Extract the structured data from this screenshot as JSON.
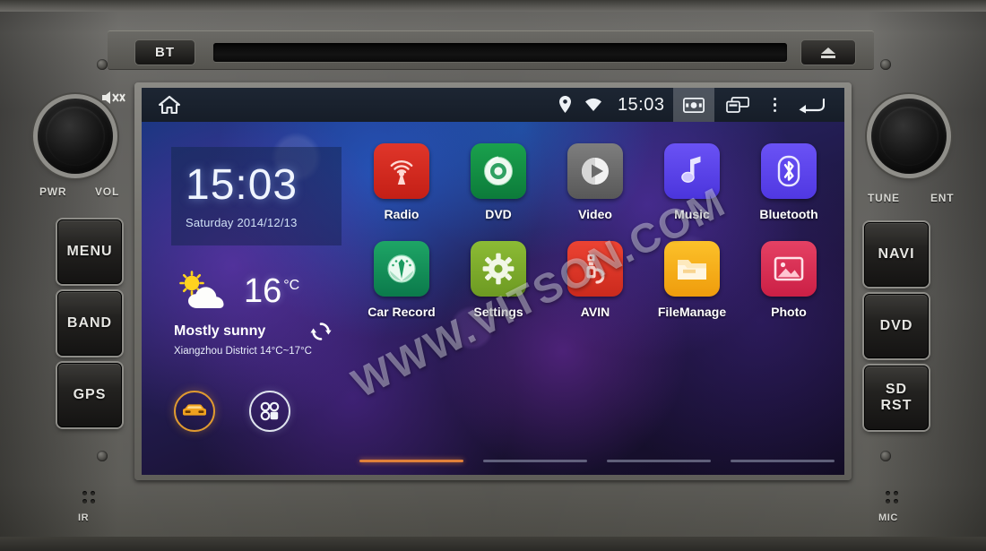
{
  "device": {
    "top": {
      "bt_label": "BT",
      "eject_icon": "eject-icon",
      "disc_slot": "disc-slot"
    },
    "left": {
      "knob_icon": "volume-knob",
      "mute_icon": "mute-icon",
      "label_pwr": "PWR",
      "label_vol": "VOL",
      "buttons": [
        {
          "label": "MENU",
          "name": "menu-button"
        },
        {
          "label": "BAND",
          "name": "band-button"
        },
        {
          "label": "GPS",
          "name": "gps-button"
        }
      ]
    },
    "right": {
      "knob_icon": "tune-knob",
      "label_tune": "TUNE",
      "label_ent": "ENT",
      "buttons": [
        {
          "label": "NAVI",
          "name": "navi-button"
        },
        {
          "label": "DVD",
          "name": "dvd-button"
        },
        {
          "label_line1": "SD",
          "label_line2": "RST",
          "name": "sd-rst-button"
        }
      ]
    },
    "bottom": {
      "ir_label": "IR",
      "mic_label": "MIC"
    }
  },
  "screen": {
    "statusbar": {
      "home_icon": "home-icon",
      "location_icon": "location-pin-icon",
      "wifi_icon": "wifi-icon",
      "clock": "15:03",
      "screenshot_icon": "screenshot-icon",
      "recents_icon": "recents-icon",
      "overflow_icon": "overflow-menu-icon",
      "back_icon": "back-arrow-icon"
    },
    "clock_widget": {
      "time": "15:03",
      "date": "Saturday 2014/12/13"
    },
    "weather_widget": {
      "icon": "sun-behind-cloud-icon",
      "temperature": "16",
      "unit": "°C",
      "condition": "Mostly sunny",
      "location_range": "Xiangzhou District 14°C~17°C",
      "refresh_icon": "refresh-icon"
    },
    "dock": [
      {
        "name": "car-mode-button",
        "icon": "car-icon"
      },
      {
        "name": "app-drawer-button",
        "icon": "apps-grid-icon"
      }
    ],
    "apps": [
      {
        "label": "Radio",
        "name": "app-radio",
        "icon": "radio-broadcast-icon",
        "color": "#d32a20"
      },
      {
        "label": "DVD",
        "name": "app-dvd",
        "icon": "disc-icon",
        "color": "#159146"
      },
      {
        "label": "Video",
        "name": "app-video",
        "icon": "play-circle-icon",
        "color": "#6d6d6d"
      },
      {
        "label": "Music",
        "name": "app-music",
        "icon": "music-note-icon",
        "color": "#5b46e8"
      },
      {
        "label": "Bluetooth",
        "name": "app-bluetooth",
        "icon": "bluetooth-icon",
        "color": "#5b46e8"
      },
      {
        "label": "Car Record",
        "name": "app-car-record",
        "icon": "gauge-icon",
        "color": "#108a57"
      },
      {
        "label": "Settings",
        "name": "app-settings",
        "icon": "gear-icon",
        "color": "#7aa82c"
      },
      {
        "label": "AVIN",
        "name": "app-avin",
        "icon": "av-input-icon",
        "color": "#e03a2c"
      },
      {
        "label": "FileManage",
        "name": "app-filemanage",
        "icon": "folder-icon",
        "color": "#f2a316"
      },
      {
        "label": "Photo",
        "name": "app-photo",
        "icon": "image-icon",
        "color": "#d82f53"
      }
    ],
    "pages": {
      "count": 4,
      "active": 0
    },
    "watermark": "WWW.VITSON.COM"
  },
  "colors": {
    "accent_orange": "#e0803a",
    "statusbar_bg": "#1d2633",
    "bezel": "#5d5c59"
  }
}
